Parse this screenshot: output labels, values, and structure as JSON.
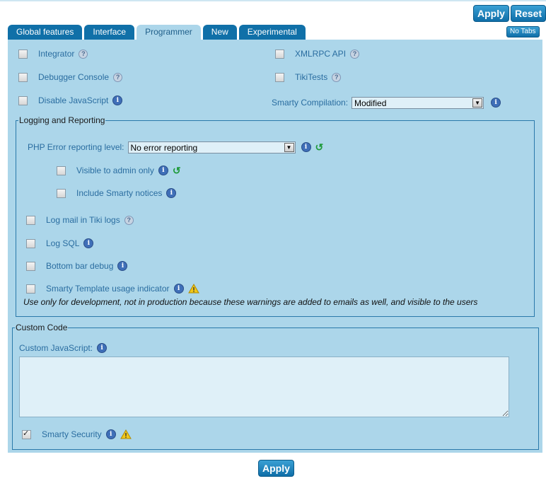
{
  "toolbar": {
    "apply_label": "Apply",
    "reset_label": "Reset",
    "notabs_label": "No Tabs"
  },
  "tabs": [
    {
      "label": "Global features",
      "active": false
    },
    {
      "label": "Interface",
      "active": false
    },
    {
      "label": "Programmer",
      "active": true
    },
    {
      "label": "New",
      "active": false
    },
    {
      "label": "Experimental",
      "active": false
    }
  ],
  "options": {
    "integrator": {
      "label": "Integrator",
      "checked": false
    },
    "xmlrpc": {
      "label": "XMLRPC API",
      "checked": false
    },
    "debugger": {
      "label": "Debugger Console",
      "checked": false
    },
    "tikitests": {
      "label": "TikiTests",
      "checked": false
    },
    "disable_js": {
      "label": "Disable JavaScript",
      "checked": false
    },
    "smarty_compilation": {
      "label": "Smarty Compilation:",
      "value": "Modified"
    }
  },
  "logging": {
    "legend": "Logging and Reporting",
    "php_error": {
      "label": "PHP Error reporting level:",
      "value": "No error reporting"
    },
    "visible_admin": {
      "label": "Visible to admin only",
      "checked": false
    },
    "smarty_notices": {
      "label": "Include Smarty notices",
      "checked": false
    },
    "log_mail": {
      "label": "Log mail in Tiki logs",
      "checked": false
    },
    "log_sql": {
      "label": "Log SQL",
      "checked": false
    },
    "bottom_bar": {
      "label": "Bottom bar debug",
      "checked": false
    },
    "smarty_template": {
      "label": "Smarty Template usage indicator",
      "checked": false
    },
    "note": "Use only for development, not in production because these warnings are added to emails as well, and visible to the users"
  },
  "custom_code": {
    "legend": "Custom Code",
    "js_label": "Custom JavaScript:",
    "js_value": "",
    "smarty_security": {
      "label": "Smarty Security",
      "checked": true
    }
  },
  "colors": {
    "panel": "#acd6ea",
    "tab": "#1070a8",
    "button": "#1f86c0",
    "link": "#2a6da0"
  }
}
